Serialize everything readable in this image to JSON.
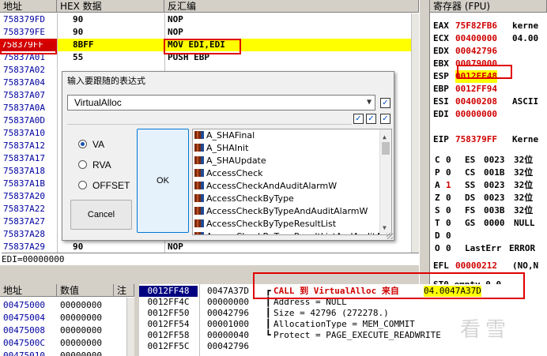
{
  "disasm": {
    "headers": {
      "addr": "地址",
      "hex": "HEX 数据",
      "asm": "反汇编"
    },
    "rows": [
      {
        "addr": "758379FD",
        "hex": "90",
        "asm": "NOP"
      },
      {
        "addr": "758379FE",
        "hex": "90",
        "asm": "NOP"
      },
      {
        "addr": "758379FF",
        "hex": "8BFF",
        "asm": "MOV EDI,EDI"
      },
      {
        "addr": "75837A01",
        "hex": "55",
        "asm": "PUSH EBP"
      },
      {
        "addr": "75837A02",
        "hex": "",
        "asm": ""
      },
      {
        "addr": "75837A04",
        "hex": "",
        "asm": ""
      },
      {
        "addr": "75837A07",
        "hex": "",
        "asm": ""
      },
      {
        "addr": "75837A0A",
        "hex": "",
        "asm": ""
      },
      {
        "addr": "75837A0D",
        "hex": "",
        "asm": ""
      },
      {
        "addr": "75837A10",
        "hex": "",
        "asm": ""
      },
      {
        "addr": "75837A12",
        "hex": "",
        "asm": ""
      },
      {
        "addr": "75837A17",
        "hex": "",
        "asm": ""
      },
      {
        "addr": "75837A18",
        "hex": "",
        "asm": ""
      },
      {
        "addr": "75837A1B",
        "hex": "",
        "asm": ""
      },
      {
        "addr": "75837A20",
        "hex": "",
        "asm": ""
      },
      {
        "addr": "75837A22",
        "hex": "",
        "asm": ""
      },
      {
        "addr": "75837A27",
        "hex": "",
        "asm": ""
      },
      {
        "addr": "75837A28",
        "hex": "",
        "asm": ""
      },
      {
        "addr": "75837A29",
        "hex": "90",
        "asm": "NOP"
      }
    ],
    "status": "EDI=00000000"
  },
  "registers": {
    "title": "寄存器 (FPU)",
    "gp": [
      {
        "name": "EAX",
        "value": "75F82FB6",
        "comment": "kerne"
      },
      {
        "name": "ECX",
        "value": "00400000",
        "comment": "04.00"
      },
      {
        "name": "EDX",
        "value": "00042796",
        "comment": ""
      },
      {
        "name": "EBX",
        "value": "00079000",
        "comment": ""
      },
      {
        "name": "ESP",
        "value": "0012FF48",
        "comment": ""
      },
      {
        "name": "EBP",
        "value": "0012FF94",
        "comment": ""
      },
      {
        "name": "ESI",
        "value": "00400208",
        "comment": "ASCII"
      },
      {
        "name": "EDI",
        "value": "00000000",
        "comment": ""
      }
    ],
    "eip": {
      "name": "EIP",
      "value": "758379FF",
      "comment": "Kerne"
    },
    "flags": [
      {
        "f": "C",
        "v": "0",
        "seg": "ES",
        "sv": "0023",
        "bits": "32位"
      },
      {
        "f": "P",
        "v": "0",
        "seg": "CS",
        "sv": "001B",
        "bits": "32位"
      },
      {
        "f": "A",
        "v": "1",
        "seg": "SS",
        "sv": "0023",
        "bits": "32位"
      },
      {
        "f": "Z",
        "v": "0",
        "seg": "DS",
        "sv": "0023",
        "bits": "32位"
      },
      {
        "f": "S",
        "v": "0",
        "seg": "FS",
        "sv": "003B",
        "bits": "32位"
      },
      {
        "f": "T",
        "v": "0",
        "seg": "GS",
        "sv": "0000",
        "bits": "NULL"
      },
      {
        "f": "D",
        "v": "0",
        "seg": "",
        "sv": "",
        "bits": ""
      },
      {
        "f": "O",
        "v": "0",
        "seg": "LastErr",
        "sv": "ERROR",
        "bits": ""
      }
    ],
    "efl": {
      "name": "EFL",
      "value": "00000212",
      "comment": "(NO,N"
    },
    "st0": "ST0 empty 0.0"
  },
  "dump": {
    "headers": {
      "addr": "地址",
      "val": "数值",
      "note": "注"
    },
    "rows": [
      {
        "addr": "00475000",
        "val": "00000000"
      },
      {
        "addr": "00475004",
        "val": "00000000"
      },
      {
        "addr": "00475008",
        "val": "00000000"
      },
      {
        "addr": "0047500C",
        "val": "00000000"
      },
      {
        "addr": "00475010",
        "val": "00000000"
      }
    ]
  },
  "stack": {
    "rows": [
      {
        "addr": "0012FF48",
        "val": "0047A37D",
        "comment": "CALL 到 VirtualAlloc 来自",
        "target": "04.0047A37D"
      },
      {
        "addr": "0012FF4C",
        "val": "00000000",
        "comment": "Address = NULL",
        "target": ""
      },
      {
        "addr": "0012FF50",
        "val": "00042796",
        "comment": "Size = 42796 (272278.)",
        "target": ""
      },
      {
        "addr": "0012FF54",
        "val": "00001000",
        "comment": "AllocationType = MEM_COMMIT",
        "target": ""
      },
      {
        "addr": "0012FF58",
        "val": "00000040",
        "comment": "Protect = PAGE_EXECUTE_READWRITE",
        "target": ""
      },
      {
        "addr": "0012FF5C",
        "val": "00042796",
        "comment": "",
        "target": ""
      }
    ]
  },
  "dialog": {
    "title": "输入要跟随的表达式",
    "expression": "VirtualAlloc",
    "options": [
      "VA",
      "RVA",
      "OFFSET"
    ],
    "selected": "VA",
    "ok_label": "OK",
    "cancel_label": "Cancel",
    "suggestions": [
      "A_SHAFinal",
      "A_SHAInit",
      "A_SHAUpdate",
      "AccessCheck",
      "AccessCheckAndAuditAlarmW",
      "AccessCheckByType",
      "AccessCheckByTypeAndAuditAlarmW",
      "AccessCheckByTypeResultList",
      "AccessCheckByTypeResultListAndAuditAlarm"
    ]
  },
  "watermark": "看雪",
  "colors": {
    "accent_red": "#e00000",
    "highlight_yellow": "#ffff00",
    "addr_blue": "#0000a0"
  }
}
